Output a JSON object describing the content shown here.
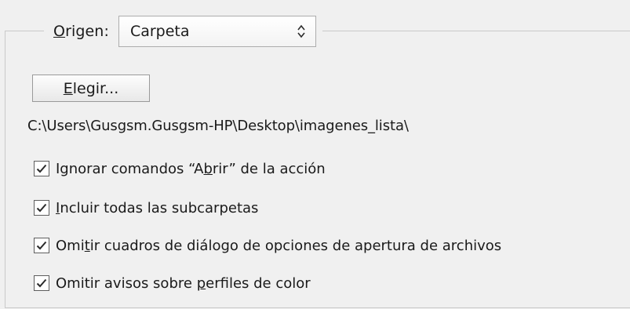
{
  "source": {
    "label_pre": "",
    "label_mnemonic": "O",
    "label_post": "rigen:",
    "selected": "Carpeta"
  },
  "choose_button": {
    "mnemonic": "E",
    "rest": "legir..."
  },
  "folder_path": "C:\\Users\\Gusgsm.Gusgsm-HP\\Desktop\\imagenes_lista\\",
  "options": [
    {
      "pre": "Ignorar comandos “A",
      "mnemonic": "b",
      "post": "rir” de la acción",
      "checked": true
    },
    {
      "pre": "",
      "mnemonic": "I",
      "post": "ncluir todas las subcarpetas",
      "checked": true
    },
    {
      "pre": "Omi",
      "mnemonic": "t",
      "post": "ir cuadros de diálogo de opciones de apertura de archivos",
      "checked": true
    },
    {
      "pre": "Omitir avisos sobre ",
      "mnemonic": "p",
      "post": "erfiles de color",
      "checked": true
    }
  ],
  "icons": {
    "select_arrows": "up-down-chevron-icon",
    "checkbox": "checkmark-icon"
  }
}
